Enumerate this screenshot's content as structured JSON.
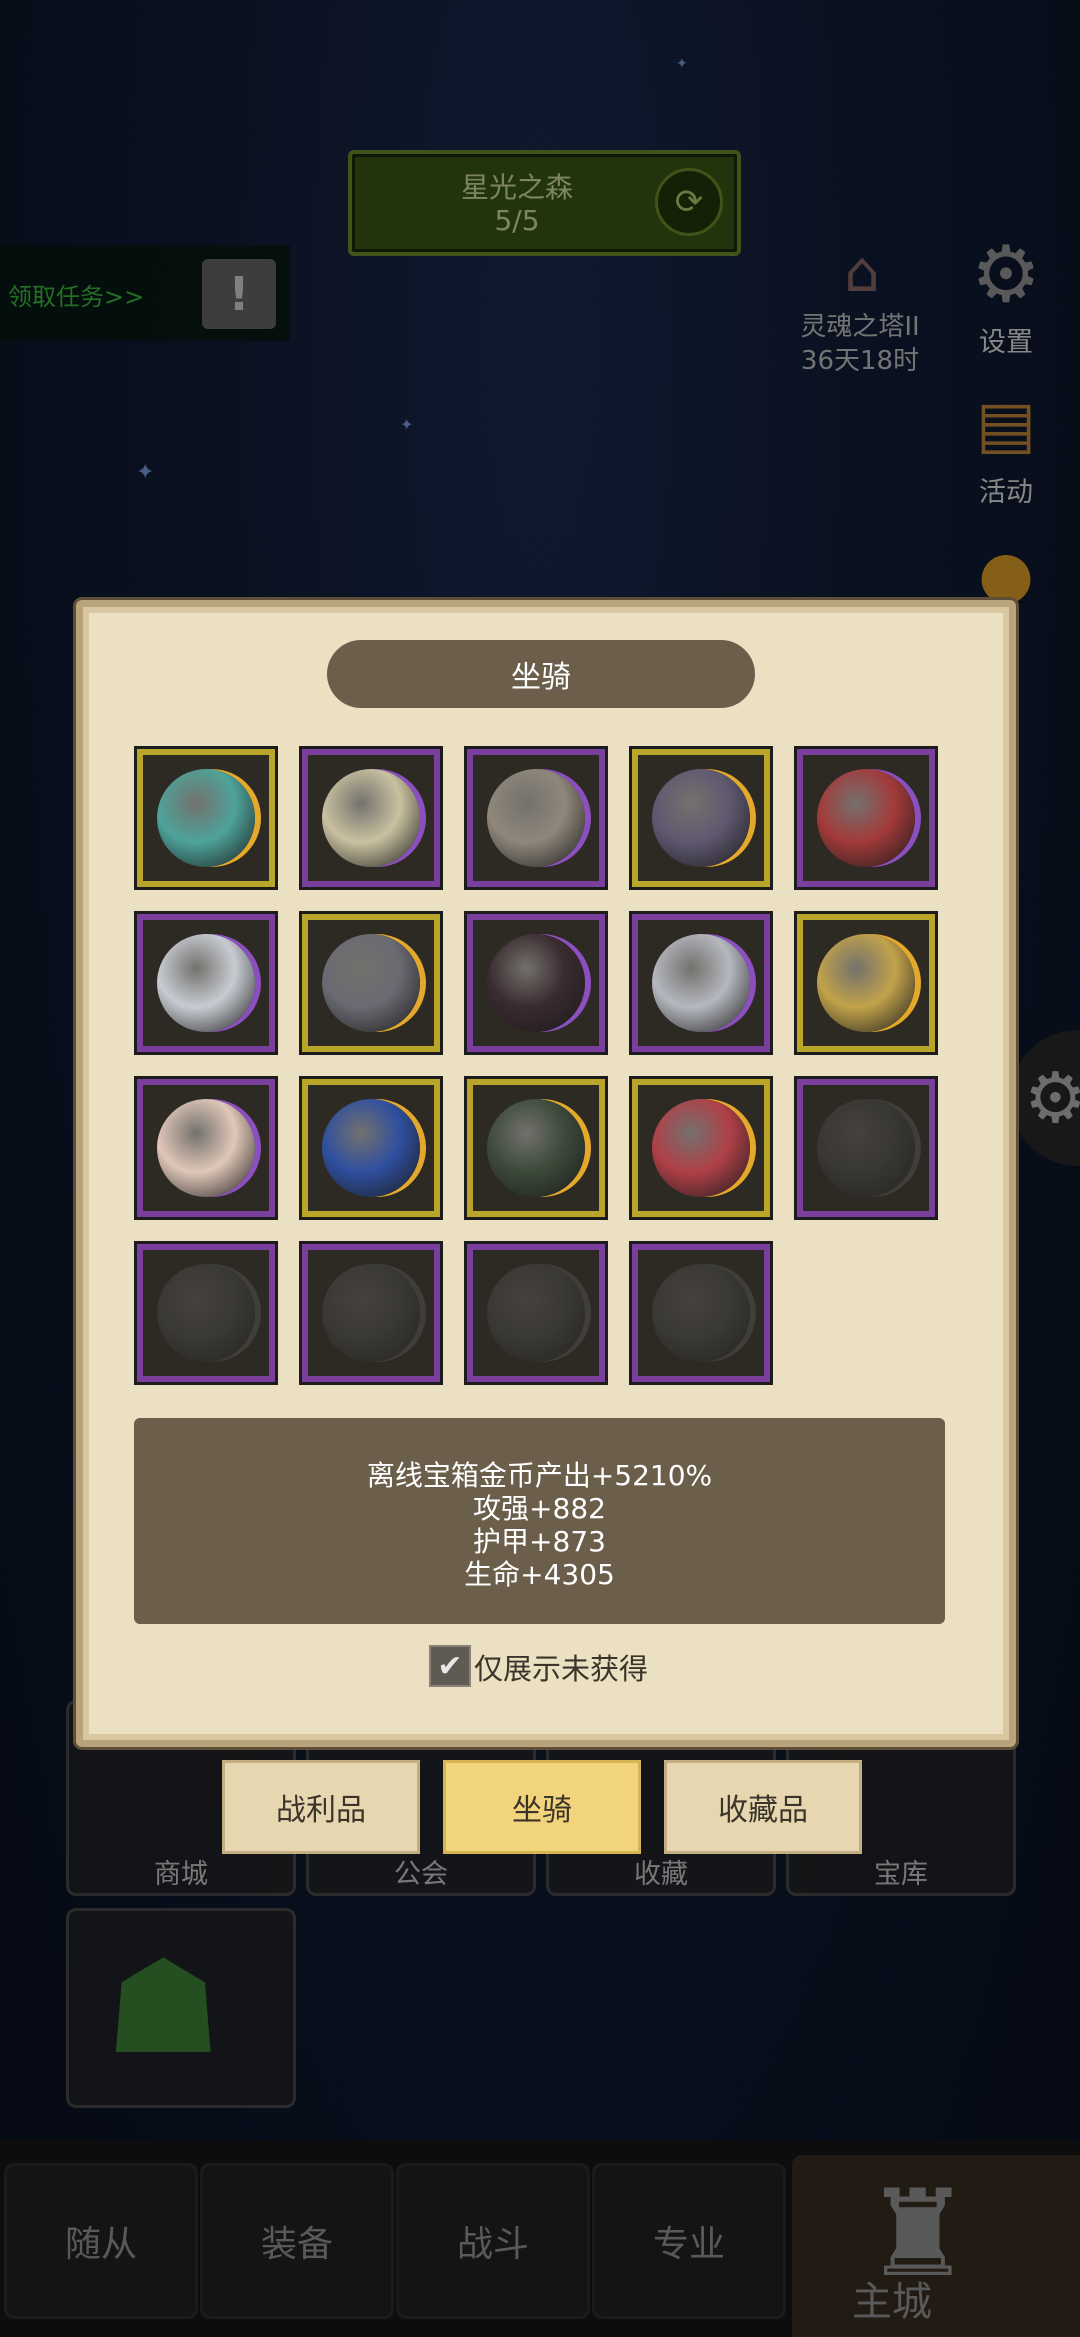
{
  "zone": {
    "name": "星光之森",
    "progress": "5/5"
  },
  "task": {
    "label": "领取任务>>",
    "icon": "!"
  },
  "event": {
    "name": "灵魂之塔II",
    "countdown": "36天18时"
  },
  "side": {
    "settings": "设置",
    "activity": "活动",
    "bag_partial": "包"
  },
  "panel": {
    "title": "坐骑",
    "slots": [
      {
        "icon": "teal-skull-mount-icon",
        "frame": "gold",
        "owned": true,
        "color": "#4ea39a"
      },
      {
        "icon": "silver-gold-mask-mount-icon",
        "frame": "purple",
        "owned": true,
        "color": "#c9c1a0"
      },
      {
        "icon": "stone-spiral-mount-icon",
        "frame": "purple",
        "owned": true,
        "color": "#8f877a"
      },
      {
        "icon": "dark-green-mech-mount-icon",
        "frame": "gold",
        "owned": true,
        "color": "#5f5870"
      },
      {
        "icon": "red-armored-mount-icon",
        "frame": "purple",
        "owned": true,
        "color": "#a33a3a"
      },
      {
        "icon": "white-crystal-mount-icon",
        "frame": "purple",
        "owned": true,
        "color": "#c8ccd2"
      },
      {
        "icon": "steel-helmet-mount-icon",
        "frame": "gold",
        "owned": true,
        "color": "#6a6a72"
      },
      {
        "icon": "red-black-demon-mount-icon",
        "frame": "purple",
        "owned": true,
        "color": "#3a2a2f"
      },
      {
        "icon": "silver-emerald-mount-icon",
        "frame": "purple",
        "owned": true,
        "color": "#b5b8bf"
      },
      {
        "icon": "golden-spiral-mount-icon",
        "frame": "gold",
        "owned": true,
        "color": "#c2a24a"
      },
      {
        "icon": "pale-bird-mount-icon",
        "frame": "purple",
        "owned": true,
        "color": "#e0c7b8"
      },
      {
        "icon": "blue-heart-mount-icon",
        "frame": "gold",
        "owned": true,
        "color": "#2f4f9f"
      },
      {
        "icon": "green-shadow-mount-icon",
        "frame": "gold",
        "owned": true,
        "color": "#3c4a3a"
      },
      {
        "icon": "red-green-mask-mount-icon",
        "frame": "gold",
        "owned": true,
        "color": "#b04048"
      },
      {
        "icon": "horse-mount-icon",
        "frame": "purple",
        "owned": false,
        "color": "#6b4a3a"
      },
      {
        "icon": "dark-dragon-mount-icon",
        "frame": "purple",
        "owned": false,
        "color": "#555"
      },
      {
        "icon": "dark-armor-mount-icon",
        "frame": "purple",
        "owned": false,
        "color": "#555"
      },
      {
        "icon": "shadow-beast-mount-icon",
        "frame": "purple",
        "owned": false,
        "color": "#555"
      },
      {
        "icon": "iron-knight-mount-icon",
        "frame": "purple",
        "owned": false,
        "color": "#555"
      }
    ],
    "stats": [
      "离线宝箱金币产出+5210%",
      "攻强+882",
      "护甲+873",
      "生命+4305"
    ],
    "checkbox_label": "仅展示未获得",
    "checkbox_checked": true
  },
  "tabs": [
    "战利品",
    "坐骑",
    "收藏品"
  ],
  "active_tab": "坐骑",
  "tiles": [
    "商城",
    "公会",
    "收藏",
    "宝库"
  ],
  "nav": [
    "随从",
    "装备",
    "战斗",
    "专业",
    "主城"
  ],
  "colors": {
    "gold_frame": "#b8a52a",
    "purple_frame": "#7a3f9c",
    "active_tab": "#f2d47c"
  }
}
